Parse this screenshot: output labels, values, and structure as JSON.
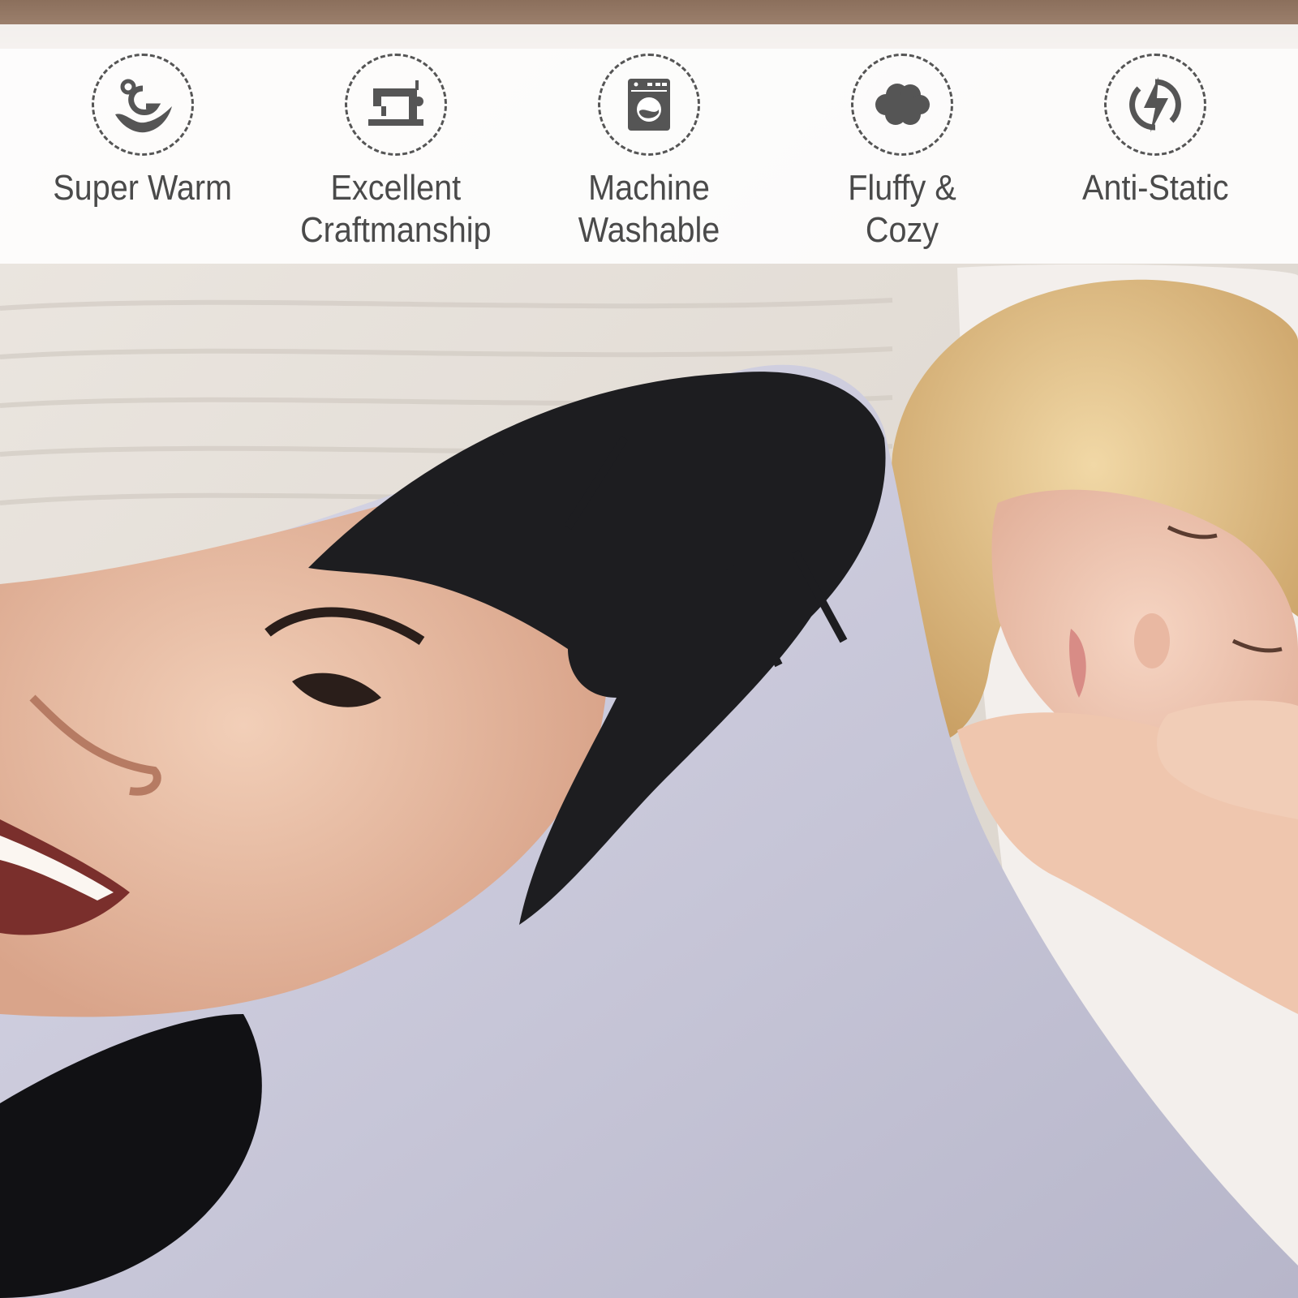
{
  "features": [
    {
      "icon": "super-warm-icon",
      "label": "Super Warm"
    },
    {
      "icon": "sewing-machine-icon",
      "label": "Excellent\nCraftmanship"
    },
    {
      "icon": "washing-machine-icon",
      "label": "Machine\nWashable"
    },
    {
      "icon": "cloud-icon",
      "label": "Fluffy & Cozy"
    },
    {
      "icon": "lightning-bolt-icon",
      "label": "Anti-Static"
    }
  ],
  "colors": {
    "icon": "#555555",
    "label": "#4a4a4a",
    "blanket": "#c9c8d9",
    "banner": "#ffffff"
  }
}
